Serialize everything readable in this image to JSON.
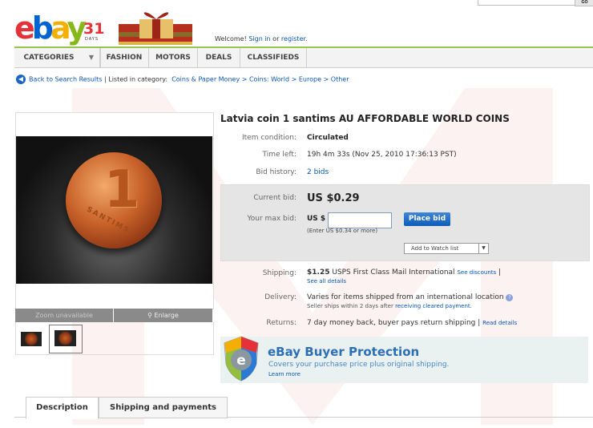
{
  "header": {
    "logo_letters": [
      "e",
      "b",
      "a",
      "y"
    ],
    "logo_colors": [
      "#e53238",
      "#0064d2",
      "#f5af02",
      "#86b817"
    ],
    "days_number": "31",
    "days_label": "DAYS",
    "welcome_prefix": "Welcome! ",
    "sign_in": "Sign in",
    "or_text": " or ",
    "register": "register",
    "welcome_suffix": ".",
    "search_button": "GO"
  },
  "nav": {
    "items": [
      "CATEGORIES",
      "FASHION",
      "MOTORS",
      "DEALS",
      "CLASSIFIEDS"
    ],
    "dropdown_icon": "chevron-down-icon"
  },
  "breadcrumb": {
    "back": "Back to Search Results",
    "separator": "|",
    "listed_in": "Listed in category:",
    "path": "Coins & Paper Money > Coins: World > Europe > Other"
  },
  "gallery": {
    "coin_digit": "1",
    "coin_text": "SANTIMS",
    "zoom": "Zoom unavailable",
    "enlarge": "Enlarge",
    "enlarge_icon": "magnifier-icon"
  },
  "item": {
    "title": "Latvia coin 1 santims AU AFFORDABLE WORLD COINS",
    "condition_label": "Item condition:",
    "condition_value": "Circulated",
    "time_label": "Time left:",
    "time_value": "19h 4m 33s (Nov 25, 2010 17:36:13 PST)",
    "history_label": "Bid history:",
    "history_value": "2 bids"
  },
  "bid": {
    "current_label": "Current bid:",
    "current_value": "US $0.29",
    "max_label": "Your max bid:",
    "currency": "US $",
    "input_value": "",
    "hint": "(Enter US $0.34 or more)",
    "place_bid": "Place bid",
    "watch_list": "Add to Watch list"
  },
  "shipping": {
    "label": "Shipping:",
    "price": "$1.25",
    "method": " USPS First Class Mail International",
    "discounts": "See discounts",
    "pipe": "|",
    "details": "See all details"
  },
  "delivery": {
    "label": "Delivery:",
    "text": "Varies for items shipped from an international location",
    "info_icon": "info-icon",
    "sub_prefix": "Seller ships within 2 days after ",
    "sub_link": "receiving cleared payment",
    "sub_suffix": "."
  },
  "returns": {
    "label": "Returns:",
    "text": "7 day money back, buyer pays return shipping",
    "pipe": " | ",
    "link": "Read details"
  },
  "protection": {
    "title": "eBay Buyer Protection",
    "subtitle": "Covers your purchase price plus original shipping.",
    "learn": "Learn more"
  },
  "tabs": [
    "Description",
    "Shipping and payments"
  ]
}
